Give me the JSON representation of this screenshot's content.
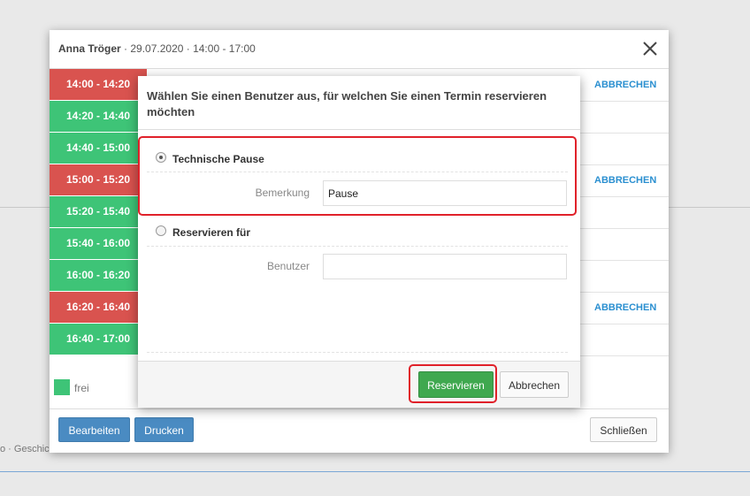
{
  "background": {
    "text": "o · Geschich"
  },
  "dialog": {
    "title_name": "Anna Tröger",
    "title_details": "· 29.07.2020 · 14:00 - 17:00",
    "slots": [
      {
        "label": "14:00 - 14:20",
        "status": "busy"
      },
      {
        "label": "14:20 - 14:40",
        "status": "free"
      },
      {
        "label": "14:40 - 15:00",
        "status": "free"
      },
      {
        "label": "15:00 - 15:20",
        "status": "busy"
      },
      {
        "label": "15:20 - 15:40",
        "status": "free"
      },
      {
        "label": "15:40 - 16:00",
        "status": "free"
      },
      {
        "label": "16:00 - 16:20",
        "status": "free"
      },
      {
        "label": "16:20 - 16:40",
        "status": "busy"
      },
      {
        "label": "16:40 - 17:00",
        "status": "free"
      }
    ],
    "row_action": "ABBRECHEN",
    "legend_label": "frei",
    "buttons": {
      "edit": "Bearbeiten",
      "print": "Drucken",
      "close": "Schließen"
    },
    "colors": {
      "busy": "#d9534f",
      "free": "#3ec477",
      "link": "#2a8fd0",
      "primary": "#4a8bc2"
    }
  },
  "modal": {
    "title": "Wählen Sie einen Benutzer aus, für welchen Sie einen Termin reservieren möchten",
    "option_pause": {
      "label": "Technische Pause",
      "selected": true
    },
    "remark": {
      "label": "Bemerkung",
      "value": "Pause"
    },
    "option_reserve": {
      "label": "Reservieren für",
      "selected": false
    },
    "user": {
      "label": "Benutzer",
      "value": ""
    },
    "buttons": {
      "reserve": "Reservieren",
      "cancel": "Abbrechen"
    },
    "colors": {
      "highlight": "#e0212a",
      "success": "#3fa84f"
    }
  }
}
